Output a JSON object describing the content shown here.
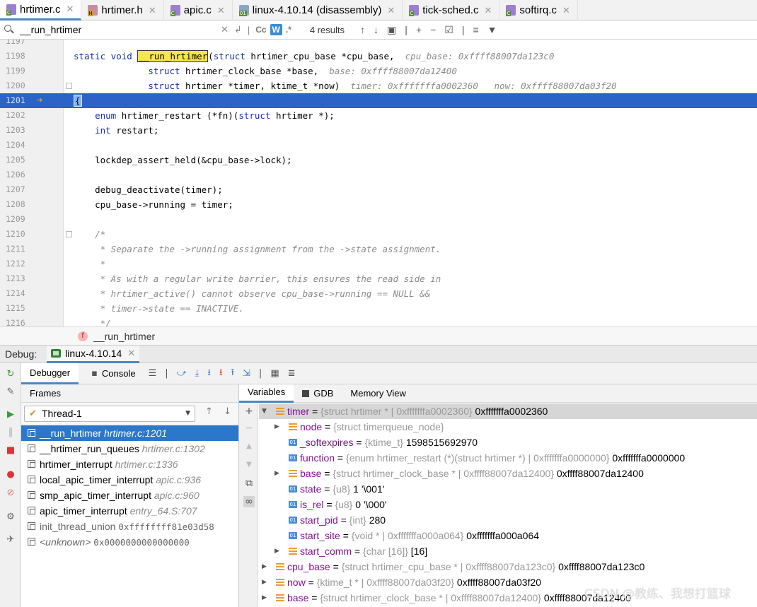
{
  "tabs": [
    {
      "label": "hrtimer.c",
      "type": "c",
      "active": true
    },
    {
      "label": "hrtimer.h",
      "type": "h",
      "active": false
    },
    {
      "label": "apic.c",
      "type": "c",
      "active": false
    },
    {
      "label": "linux-4.10.14 (disassembly)",
      "type": "dis",
      "active": false
    },
    {
      "label": "tick-sched.c",
      "type": "c",
      "active": false
    },
    {
      "label": "softirq.c",
      "type": "c",
      "active": false
    }
  ],
  "search": {
    "value": "__run_hrtimer",
    "results": "4 results",
    "match_case": "Cc",
    "words": "W",
    "regex": ".*"
  },
  "editor": {
    "lines": [
      {
        "num": "1197",
        "html": ""
      },
      {
        "num": "1198",
        "html": "<span class='kw'>static void</span> <span class='fnmatch'>__run_hrtimer</span>(<span class='kw'>struct</span> hrtimer_cpu_base *cpu_base,  <span class='hint'>cpu_base: 0xffff88007da123c0</span>"
      },
      {
        "num": "1199",
        "html": "              <span class='kw'>struct</span> hrtimer_clock_base *base,  <span class='hint'>base: 0xffff88007da12400</span>"
      },
      {
        "num": "1200",
        "html": "              <span class='kw'>struct</span> hrtimer *timer, ktime_t *now)  <span class='hint'>timer: 0xfffffffa0002360   now: 0xffff88007da03f20</span>"
      },
      {
        "num": "1201",
        "html": "<span class='brace-hl'>{</span>",
        "highlight": true
      },
      {
        "num": "1202",
        "html": "    <span class='kw'>enum</span> hrtimer_restart (*fn)(<span class='kw'>struct</span> hrtimer *);"
      },
      {
        "num": "1203",
        "html": "    <span class='kw'>int</span> restart;"
      },
      {
        "num": "1204",
        "html": ""
      },
      {
        "num": "1205",
        "html": "    lockdep_assert_held(&amp;cpu_base->lock);"
      },
      {
        "num": "1206",
        "html": ""
      },
      {
        "num": "1207",
        "html": "    debug_deactivate(timer);"
      },
      {
        "num": "1208",
        "html": "    cpu_base->running = timer;"
      },
      {
        "num": "1209",
        "html": ""
      },
      {
        "num": "1210",
        "html": "    <span class='cmt'>/*</span>"
      },
      {
        "num": "1211",
        "html": "<span class='cmt'>     * Separate the ->running assignment from the ->state assignment.</span>"
      },
      {
        "num": "1212",
        "html": "<span class='cmt'>     *</span>"
      },
      {
        "num": "1213",
        "html": "<span class='cmt'>     * As with a regular write barrier, this ensures the read side in</span>"
      },
      {
        "num": "1214",
        "html": "<span class='cmt'>     * hrtimer_active() cannot observe cpu_base->running == NULL &amp;&amp;</span>"
      },
      {
        "num": "1215",
        "html": "<span class='cmt'>     * timer->state == INACTIVE.</span>"
      },
      {
        "num": "1216",
        "html": "<span class='cmt'>     */</span>"
      }
    ]
  },
  "breadcrumb": {
    "icon": "f",
    "label": "__run_hrtimer"
  },
  "debug": {
    "title": "Debug:",
    "session": "linux-4.10.14",
    "tabs": [
      "Debugger",
      "Console"
    ],
    "frames_header": "Frames",
    "thread": "Thread-1",
    "frames": [
      {
        "name": "__run_hrtimer",
        "loc": "hrtimer.c:1201",
        "selected": true
      },
      {
        "name": "__hrtimer_run_queues",
        "loc": "hrtimer.c:1302"
      },
      {
        "name": "hrtimer_interrupt",
        "loc": "hrtimer.c:1336"
      },
      {
        "name": "local_apic_timer_interrupt",
        "loc": "apic.c:936"
      },
      {
        "name": "smp_apic_timer_interrupt",
        "loc": "apic.c:960"
      },
      {
        "name": "apic_timer_interrupt",
        "loc": "entry_64.S:707"
      },
      {
        "name": "init_thread_union",
        "loc": "0xffffffff81e03d58",
        "gray": true
      },
      {
        "name": "<unknown>",
        "loc": "0x0000000000000000",
        "gray": true,
        "italic": true
      }
    ],
    "var_tabs": [
      "Variables",
      "GDB",
      "Memory View"
    ],
    "variables": [
      {
        "indent": 0,
        "expand": "open",
        "icon": "struct",
        "name": "timer",
        "type": "{struct hrtimer * | 0xfffffffa0002360}",
        "value": "0xfffffffa0002360",
        "selected": true
      },
      {
        "indent": 1,
        "expand": "closed",
        "icon": "struct",
        "name": "node",
        "type": "{struct timerqueue_node}",
        "value": ""
      },
      {
        "indent": 1,
        "expand": "none",
        "icon": "prim",
        "name": "_softexpires",
        "type": "{ktime_t}",
        "value": "1598515692970"
      },
      {
        "indent": 1,
        "expand": "none",
        "icon": "prim",
        "name": "function",
        "type": "{enum hrtimer_restart (*)(struct hrtimer *) | 0xfffffffa0000000}",
        "value": "0xfffffffa0000000"
      },
      {
        "indent": 1,
        "expand": "closed",
        "icon": "struct",
        "name": "base",
        "type": "{struct hrtimer_clock_base * | 0xffff88007da12400}",
        "value": "0xffff88007da12400"
      },
      {
        "indent": 1,
        "expand": "none",
        "icon": "prim",
        "name": "state",
        "type": "{u8}",
        "value": "1 '\\001'"
      },
      {
        "indent": 1,
        "expand": "none",
        "icon": "prim",
        "name": "is_rel",
        "type": "{u8}",
        "value": "0 '\\000'"
      },
      {
        "indent": 1,
        "expand": "none",
        "icon": "prim",
        "name": "start_pid",
        "type": "{int}",
        "value": "280"
      },
      {
        "indent": 1,
        "expand": "none",
        "icon": "prim",
        "name": "start_site",
        "type": "{void * | 0xfffffffa000a064}",
        "value": "0xfffffffa000a064"
      },
      {
        "indent": 1,
        "expand": "closed",
        "icon": "struct",
        "name": "start_comm",
        "type": "{char [16]}",
        "value": "[16]"
      },
      {
        "indent": 0,
        "expand": "closed",
        "icon": "struct",
        "name": "cpu_base",
        "type": "{struct hrtimer_cpu_base * | 0xffff88007da123c0}",
        "value": "0xffff88007da123c0"
      },
      {
        "indent": 0,
        "expand": "closed",
        "icon": "struct",
        "name": "now",
        "type": "{ktime_t * | 0xffff88007da03f20}",
        "value": "0xffff88007da03f20"
      },
      {
        "indent": 0,
        "expand": "closed",
        "icon": "struct",
        "name": "base",
        "type": "{struct hrtimer_clock_base * | 0xffff88007da12400}",
        "value": "0xffff88007da12400"
      }
    ]
  },
  "watermark": "CSDN @教练、我想打篮球",
  "colors": {
    "accent": "#2c77c9",
    "current_line": "#2b63c6",
    "var_name": "#871094"
  }
}
